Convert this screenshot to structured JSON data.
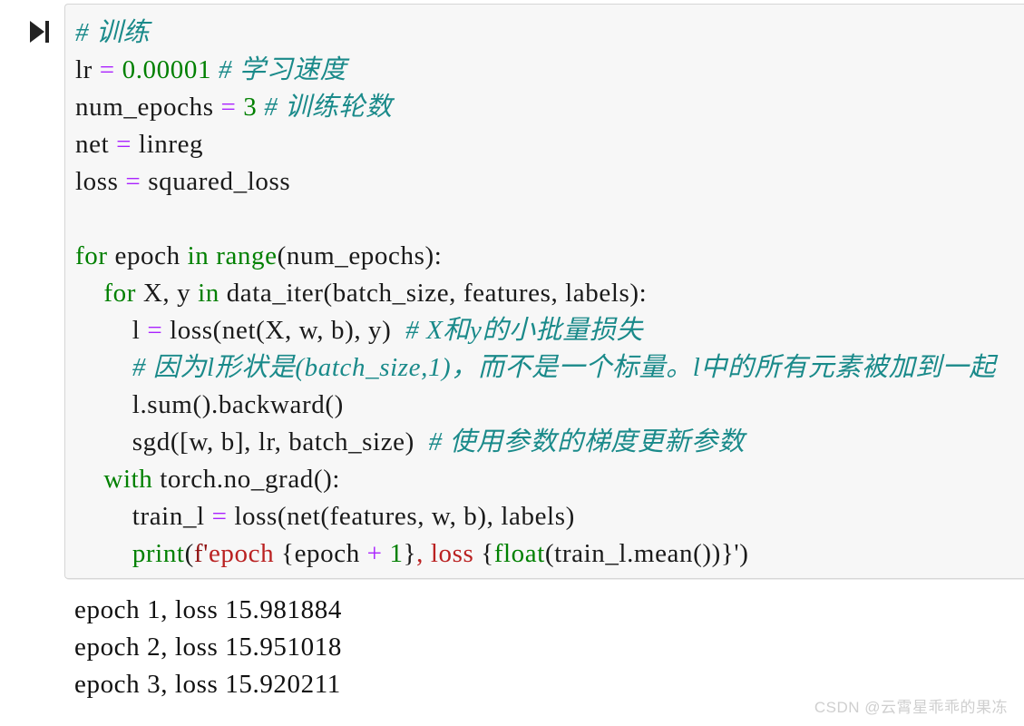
{
  "cell": {
    "run_button": {
      "name": "run-cell",
      "icon": "play-to-bar-icon",
      "color": "#222222"
    },
    "code_background": "#f7f7f7",
    "code_border": "#d6d6d6",
    "syntax_colors": {
      "keyword": "#008000",
      "builtin": "#008000",
      "operator": "#aa22ff",
      "number": "#008000",
      "string": "#ba2121",
      "comment": "#1a8a8a",
      "plain": "#1a1a1a"
    },
    "code_lines": [
      [
        {
          "t": "# 训练",
          "c": "cmt"
        }
      ],
      [
        {
          "t": "lr ",
          "c": "plain"
        },
        {
          "t": "=",
          "c": "op"
        },
        {
          "t": " ",
          "c": "plain"
        },
        {
          "t": "0.00001",
          "c": "num"
        },
        {
          "t": " ",
          "c": "plain"
        },
        {
          "t": "# 学习速度",
          "c": "cmt"
        }
      ],
      [
        {
          "t": "num_epochs ",
          "c": "plain"
        },
        {
          "t": "=",
          "c": "op"
        },
        {
          "t": " ",
          "c": "plain"
        },
        {
          "t": "3",
          "c": "num"
        },
        {
          "t": " ",
          "c": "plain"
        },
        {
          "t": "# 训练轮数",
          "c": "cmt"
        }
      ],
      [
        {
          "t": "net ",
          "c": "plain"
        },
        {
          "t": "=",
          "c": "op"
        },
        {
          "t": " linreg",
          "c": "plain"
        }
      ],
      [
        {
          "t": "loss ",
          "c": "plain"
        },
        {
          "t": "=",
          "c": "op"
        },
        {
          "t": " squared_loss",
          "c": "plain"
        }
      ],
      [
        {
          "t": "",
          "c": "plain"
        }
      ],
      [
        {
          "t": "for",
          "c": "kw"
        },
        {
          "t": " epoch ",
          "c": "plain"
        },
        {
          "t": "in",
          "c": "kw"
        },
        {
          "t": " ",
          "c": "plain"
        },
        {
          "t": "range",
          "c": "builtin"
        },
        {
          "t": "(num_epochs):",
          "c": "plain"
        }
      ],
      [
        {
          "t": "    ",
          "c": "plain"
        },
        {
          "t": "for",
          "c": "kw"
        },
        {
          "t": " X, y ",
          "c": "plain"
        },
        {
          "t": "in",
          "c": "kw"
        },
        {
          "t": " data_iter(batch_size, features, labels):",
          "c": "plain"
        }
      ],
      [
        {
          "t": "        l ",
          "c": "plain"
        },
        {
          "t": "=",
          "c": "op"
        },
        {
          "t": " loss(net(X, w, b), y)  ",
          "c": "plain"
        },
        {
          "t": "# X和y的小批量损失",
          "c": "cmt"
        }
      ],
      [
        {
          "t": "        ",
          "c": "plain"
        },
        {
          "t": "# 因为l形状是(batch_size,1)，而不是一个标量。l中的所有元素被加到一起",
          "c": "cmt"
        }
      ],
      [
        {
          "t": "        l.sum().backward()",
          "c": "plain"
        }
      ],
      [
        {
          "t": "        sgd([w, b], lr, batch_size)  ",
          "c": "plain"
        },
        {
          "t": "# 使用参数的梯度更新参数",
          "c": "cmt"
        }
      ],
      [
        {
          "t": "    ",
          "c": "plain"
        },
        {
          "t": "with",
          "c": "kw"
        },
        {
          "t": " torch.no_grad():",
          "c": "plain"
        }
      ],
      [
        {
          "t": "        train_l ",
          "c": "plain"
        },
        {
          "t": "=",
          "c": "op"
        },
        {
          "t": " loss(net(features, w, b), labels)",
          "c": "plain"
        }
      ],
      [
        {
          "t": "        ",
          "c": "plain"
        },
        {
          "t": "print",
          "c": "builtin"
        },
        {
          "t": "(",
          "c": "plain"
        },
        {
          "t": "f'",
          "c": "strpre"
        },
        {
          "t": "epoch ",
          "c": "str"
        },
        {
          "t": "{epoch ",
          "c": "plain"
        },
        {
          "t": "+",
          "c": "op"
        },
        {
          "t": " ",
          "c": "plain"
        },
        {
          "t": "1",
          "c": "num"
        },
        {
          "t": "}",
          "c": "plain"
        },
        {
          "t": ", loss ",
          "c": "str"
        },
        {
          "t": "{",
          "c": "plain"
        },
        {
          "t": "float",
          "c": "builtin"
        },
        {
          "t": "(train_l.mean())",
          "c": "plain"
        },
        {
          "t": "}')",
          "c": "plain"
        }
      ]
    ]
  },
  "output": {
    "lines": [
      "epoch 1, loss 15.981884",
      "epoch 2, loss 15.951018",
      "epoch 3, loss 15.920211"
    ]
  },
  "watermark": {
    "text": "CSDN @云霄星乖乖的果冻",
    "color": "#cfcfcf"
  }
}
